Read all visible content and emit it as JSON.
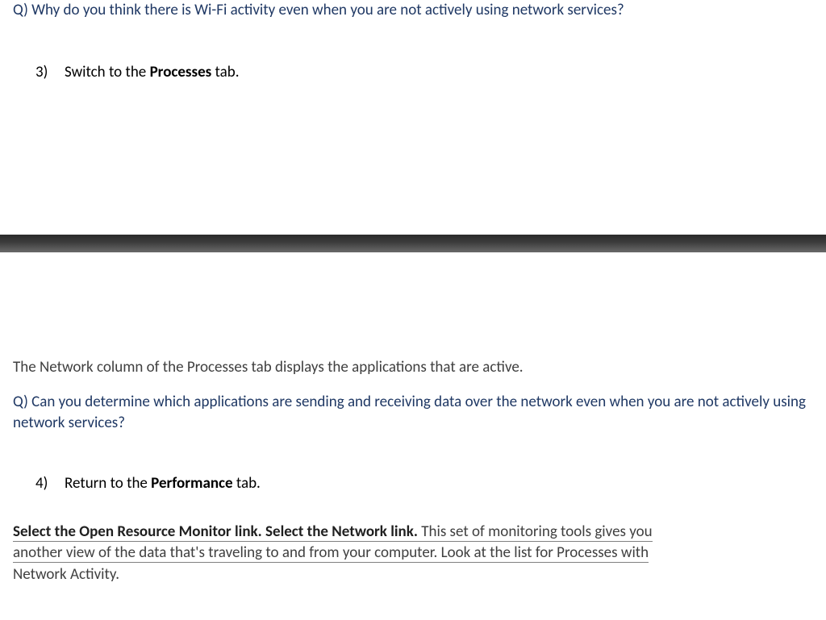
{
  "q1": {
    "text": "Q) Why do you think there is Wi-Fi activity even when you are not actively using network services?"
  },
  "step3": {
    "num": "3)",
    "label_prefix": "Switch to the ",
    "label_bold": "Processes",
    "label_suffix": " tab."
  },
  "body1": "The Network column of the Processes tab displays the applications that are active.",
  "q2": {
    "text": "Q) Can you determine which applications are sending and receiving data over the network even when you are not actively using network services?"
  },
  "step4": {
    "num": "4)",
    "label_prefix": "Return to the ",
    "label_bold": "Performance",
    "label_suffix": " tab."
  },
  "final": {
    "bold1_a": "Select the ",
    "bold1_b": "Open Resource Monitor",
    "bold1_c": " link. Select the ",
    "bold1_d": "Network",
    "bold1_e": " link.",
    "rest_line1": " This set of monitoring tools gives you ",
    "rest_line2": "another view of the data that's traveling to and from your computer. Look at the list for Processes with ",
    "rest_line3": "Network Activity."
  }
}
